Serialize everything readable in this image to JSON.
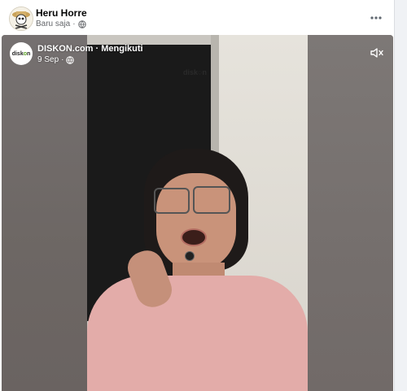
{
  "post": {
    "author": "Heru Horre",
    "timestamp": "Baru saja",
    "sep": "·"
  },
  "video": {
    "page_name": "DISKON.com",
    "follow_label": "Mengikuti",
    "sep": "·",
    "date": "9 Sep",
    "badge_text_1": "disk",
    "badge_text_2": "o",
    "badge_text_3": "n",
    "watermark": "disk○n"
  },
  "colors": {
    "accent_green": "#5aa423",
    "meta_text": "#65676b"
  },
  "icons": {
    "more": "more-horizontal-icon",
    "privacy": "globe-icon",
    "mute": "speaker-muted-icon"
  }
}
